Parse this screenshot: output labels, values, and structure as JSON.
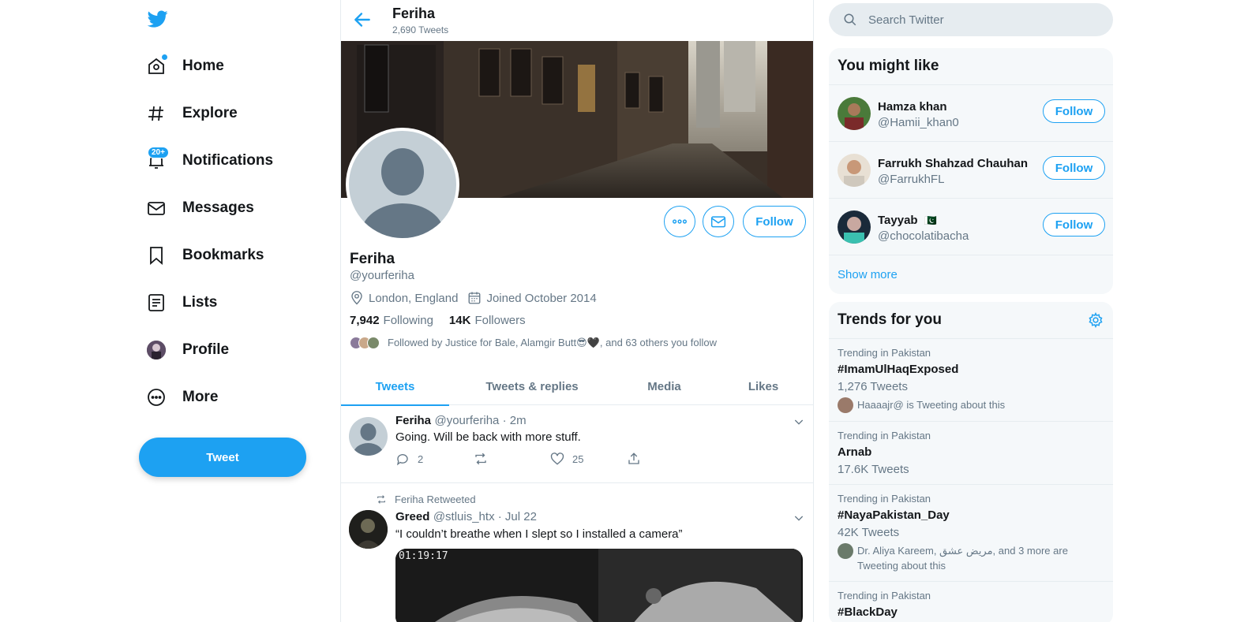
{
  "nav": {
    "items": [
      {
        "label": "Home",
        "icon": "home-icon"
      },
      {
        "label": "Explore",
        "icon": "hashtag-icon"
      },
      {
        "label": "Notifications",
        "icon": "bell-icon",
        "badge": "20+"
      },
      {
        "label": "Messages",
        "icon": "envelope-icon"
      },
      {
        "label": "Bookmarks",
        "icon": "bookmark-icon"
      },
      {
        "label": "Lists",
        "icon": "list-icon"
      },
      {
        "label": "Profile",
        "icon": "avatar"
      },
      {
        "label": "More",
        "icon": "more-circle-icon"
      }
    ],
    "tweet_button": "Tweet"
  },
  "header": {
    "name": "Feriha",
    "tweet_count": "2,690 Tweets"
  },
  "profile": {
    "name": "Feriha",
    "handle": "@yourferiha",
    "location": "London, England",
    "joined": "Joined October 2014",
    "following_count": "7,942",
    "following_label": "Following",
    "followers_count": "14K",
    "followers_label": "Followers",
    "followed_by": "Followed by Justice for Bale, Alamgir Butt😎🖤, and 63 others you follow",
    "follow_button": "Follow"
  },
  "tabs": [
    "Tweets",
    "Tweets & replies",
    "Media",
    "Likes"
  ],
  "tweets": [
    {
      "name": "Feriha",
      "meta": "@yourferiha · 2m",
      "text": "Going. Will be back with more stuff.",
      "replies": "2",
      "retweets": "",
      "likes": "25"
    },
    {
      "retweeted_by": "Feriha Retweeted",
      "name": "Greed",
      "meta": "@stluis_htx · Jul 22",
      "text": "“I couldn’t breathe when I slept so I installed a camera”",
      "video_timestamp": "01:19:17"
    }
  ],
  "search": {
    "placeholder": "Search Twitter"
  },
  "who_to_follow": {
    "title": "You might like",
    "users": [
      {
        "name": "Hamza khan",
        "handle": "@Hamii_khan0",
        "button": "Follow"
      },
      {
        "name": "Farrukh Shahzad Chauhan",
        "handle": "@FarrukhFL",
        "button": "Follow"
      },
      {
        "name": "Tayyab",
        "flag": "🇵🇰",
        "handle": "@chocolatibacha",
        "button": "Follow"
      }
    ],
    "show_more": "Show more"
  },
  "trends": {
    "title": "Trends for you",
    "items": [
      {
        "context": "Trending in Pakistan",
        "name": "#ImamUlHaqExposed",
        "count": "1,276 Tweets",
        "by": "Haaaajr@ is Tweeting about this"
      },
      {
        "context": "Trending in Pakistan",
        "name": "Arnab",
        "count": "17.6K Tweets",
        "by": ""
      },
      {
        "context": "Trending in Pakistan",
        "name": "#NayaPakistan_Day",
        "count": "42K Tweets",
        "by": "Dr. Aliya Kareem, مریض عشق, and 3 more are Tweeting about this"
      },
      {
        "context": "Trending in Pakistan",
        "name": "#BlackDay",
        "count": "",
        "by": ""
      }
    ]
  },
  "colors": {
    "accent": "#1da1f2",
    "text": "#14171a",
    "muted": "#657786",
    "panel": "#f5f8fa",
    "border": "#e6ecf0"
  }
}
